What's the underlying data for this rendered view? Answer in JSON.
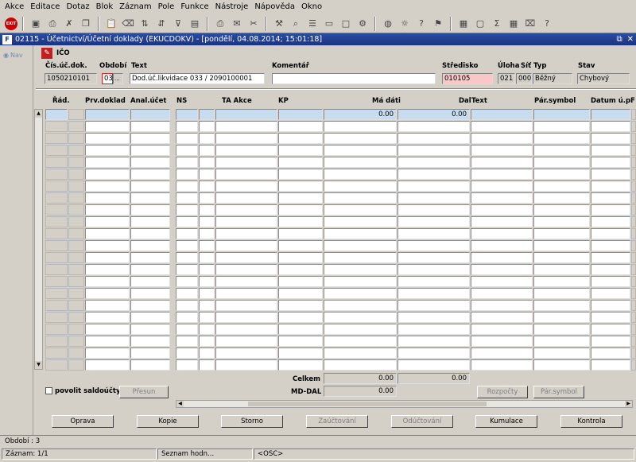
{
  "menu": [
    "Akce",
    "Editace",
    "Dotaz",
    "Blok",
    "Záznam",
    "Pole",
    "Funkce",
    "Nástroje",
    "Nápověda",
    "Okno"
  ],
  "toolbar_icons": [
    "exit-icon",
    "save-icon",
    "print-icon",
    "clear-icon",
    "copy-icon",
    "paste-icon",
    "delete-record-icon",
    "sort-asc-icon",
    "sort-desc-icon",
    "filter-icon",
    "lock-icon",
    "printer-icon",
    "mail-icon",
    "cut-icon",
    "tools-icon",
    "search-icon",
    "list-icon",
    "document-icon",
    "blank-icon",
    "cog-icon",
    "globe-icon",
    "sun-icon",
    "help-icon",
    "bookmark-icon",
    "calendar-icon",
    "window-icon",
    "sum-icon",
    "grid-icon",
    "trash-icon",
    "question-icon"
  ],
  "exit_label": "EXIT",
  "window": {
    "title": "02115 - Účetnictví/Účetní doklady (EKUCDOKV) - [pondělí, 04.08.2014; 15:01:18]",
    "icon_text": "F"
  },
  "nav": {
    "label": "Nav"
  },
  "ico": {
    "label": "IČO"
  },
  "header": {
    "doc_number_label": "Čís.úč.dok.",
    "doc_number": "1050210101",
    "period_label": "Období",
    "period": "03",
    "period_btn": "...",
    "text_label": "Text",
    "text": "Dod.úč.likvidace 033 / 2090100001",
    "comment_label": "Komentář",
    "comment": "",
    "center_label": "Středisko",
    "center": "010105",
    "task_label": "Úloha",
    "task": "021",
    "net_label": "Síť",
    "net": "000",
    "type_label": "Typ",
    "type": "Běžný",
    "state_label": "Stav",
    "state": "Chybový"
  },
  "columns": {
    "rad": "Řád.",
    "prv": "Prv.doklad",
    "anal": "Anal.účet",
    "ns": "NS",
    "ta": "TA Akce",
    "kp": "KP",
    "md": "Má dáti",
    "dal": "Dal",
    "text": "Text",
    "par": "Pár.symbol",
    "datum": "Datum ú.p."
  },
  "first_row": {
    "md": "0.00",
    "dal": "0.00"
  },
  "totals": {
    "celkem_label": "Celkem",
    "celkem_md": "0.00",
    "celkem_dal": "0.00",
    "mddal_label": "MD-DAL",
    "mddal": "0.00"
  },
  "saldo_checkbox": "povolit saldoúčty",
  "buttons": {
    "presun": "Přesun",
    "rozpocty": "Rozpočty",
    "parsymbol": "Pár.symbol",
    "oprava": "Oprava",
    "kopie": "Kopie",
    "storno": "Storno",
    "zauctovani": "Zaúčtování",
    "oductovani": "Odúčtování",
    "kumulace": "Kumulace",
    "kontrola": "Kontrola"
  },
  "status": {
    "obdobi": "Období : 3",
    "zaznam": "Záznam: 1/1",
    "seznam": "Seznam hodn...",
    "osc": "<OSC>"
  }
}
